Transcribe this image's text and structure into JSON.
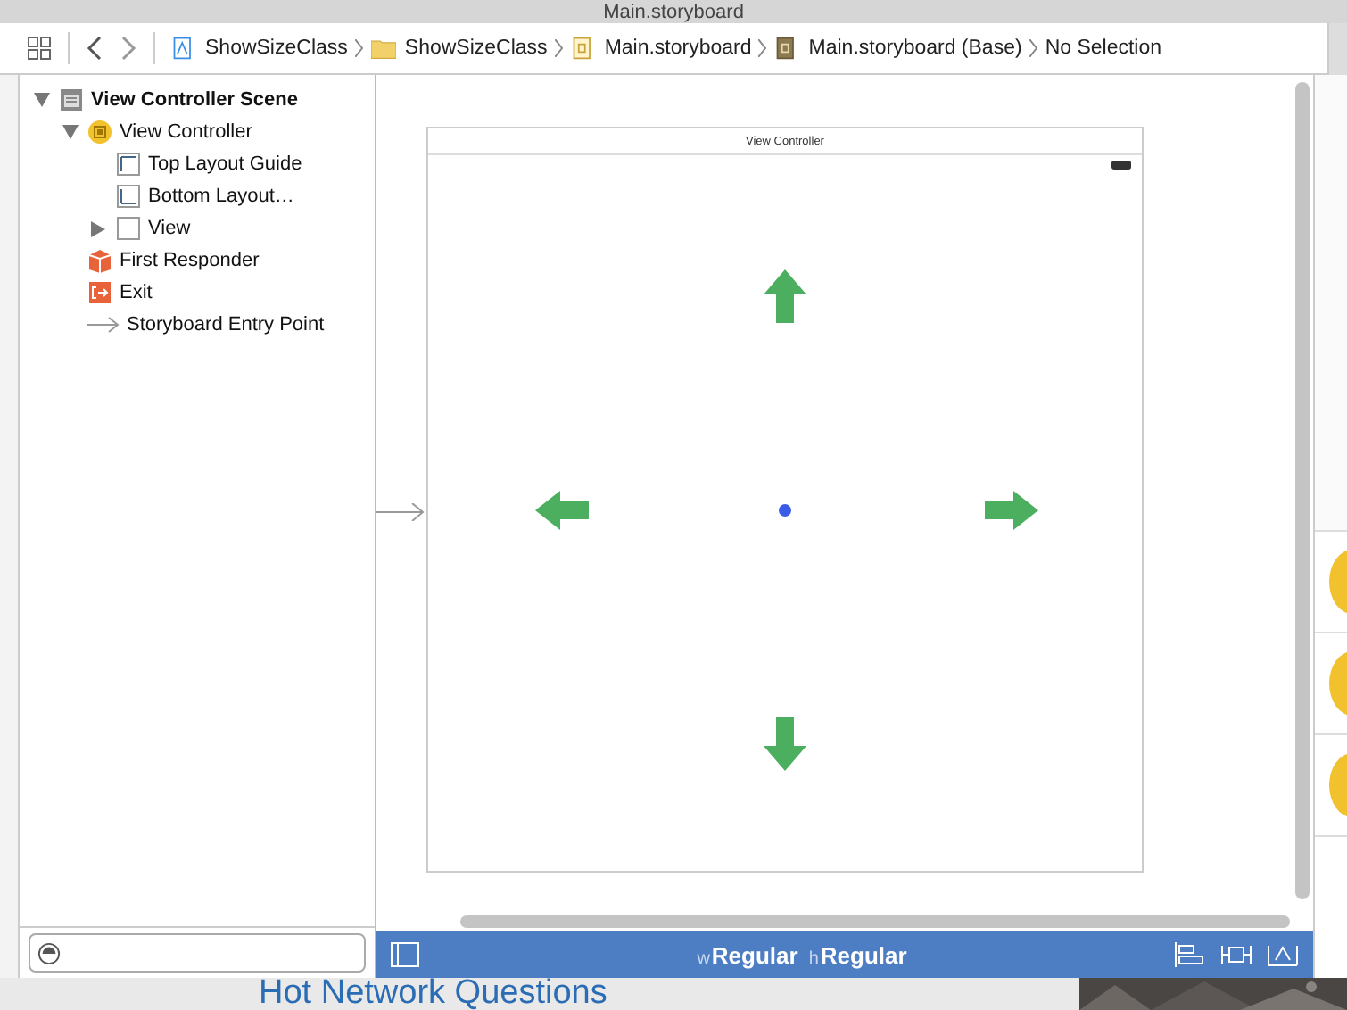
{
  "window": {
    "title": "Main.storyboard"
  },
  "jump_bar": {
    "items": [
      {
        "label": "ShowSizeClass",
        "kind": "project"
      },
      {
        "label": "ShowSizeClass",
        "kind": "folder"
      },
      {
        "label": "Main.storyboard",
        "kind": "storyboard"
      },
      {
        "label": "Main.storyboard (Base)",
        "kind": "storyboard-base"
      },
      {
        "label": "No Selection",
        "kind": "none"
      }
    ]
  },
  "outline": [
    {
      "label": "View Controller Scene",
      "kind": "scene",
      "expanded": true,
      "children": [
        {
          "label": "View Controller",
          "kind": "controller",
          "expanded": true,
          "children": [
            {
              "label": "Top Layout Guide",
              "kind": "top-guide"
            },
            {
              "label": "Bottom Layout…",
              "kind": "bottom-guide"
            },
            {
              "label": "View",
              "kind": "view",
              "expanded": false
            }
          ]
        },
        {
          "label": "First Responder",
          "kind": "responder"
        },
        {
          "label": "Exit",
          "kind": "exit"
        },
        {
          "label": "Storyboard Entry Point",
          "kind": "entry"
        }
      ]
    }
  ],
  "canvas": {
    "scene_title": "View Controller"
  },
  "size_class": {
    "width_prefix": "w",
    "width": "Regular",
    "height_prefix": "h",
    "height": "Regular"
  },
  "background": {
    "heading": "Hot Network Questions"
  }
}
